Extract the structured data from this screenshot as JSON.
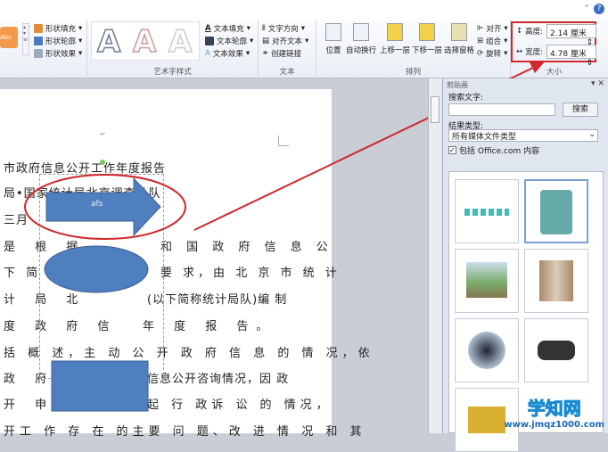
{
  "ribbon": {
    "shape_styles": {
      "fill": "形状填充",
      "outline": "形状轮廓",
      "effects": "形状效果",
      "preset": "Abc"
    },
    "wordart": {
      "group": "艺术字样式",
      "letter": "A",
      "fill": "文本填充",
      "outline": "文本轮廓",
      "effects": "文本效果"
    },
    "text": {
      "group": "文本",
      "direction": "文字方向",
      "align": "对齐文本",
      "link": "创建链接"
    },
    "arrange": {
      "group": "排列",
      "position": "位置",
      "wrap": "自动换行",
      "forward": "上移一层",
      "backward": "下移一层",
      "selection_pane": "选择窗格",
      "align": "对齐",
      "group_btn": "组合",
      "rotate": "旋转"
    },
    "size": {
      "group": "大小",
      "height_label": "高度:",
      "height_value": "2.14 厘米",
      "width_label": "宽度:",
      "width_value": "4.78 厘米"
    }
  },
  "document": {
    "lines": [
      "市政府信息公开工作年度报告",
      "局•国家统计局北京调查总队",
      "三月",
      "是 根 据",
      "和 国 政 府 信 息 公",
      "下 简 称 《 条 例 》 要 求，由 北 京 市 统 计",
      "计 局 北",
      "(以下简称统计局队)编 制",
      "度 政 府 信",
      "年 度 报 告。",
      "括 概 述，主 动 公 开 政 府 信 息 的 情 况，依",
      "政 府 信",
      "信息公开咨询情况，因 政",
      "开 申 请",
      "起 行 政诉 讼 的 情况，",
      "开工 作 存 在 的主要 问 题、改 进 情 况 和 其"
    ],
    "arrow_text": "afs"
  },
  "clipart": {
    "title": "剪贴画",
    "search_label": "搜索文字:",
    "search_value": "",
    "search_button": "搜索",
    "results_label": "结果类型:",
    "results_value": "所有媒体文件类型",
    "include_office": "包括 Office.com 内容",
    "include_checked": true
  },
  "watermark": {
    "site": "学知网",
    "url": "www.jmqz1000.com"
  },
  "colors": {
    "highlight": "#d0282c",
    "shape": "#4f7fbf"
  }
}
